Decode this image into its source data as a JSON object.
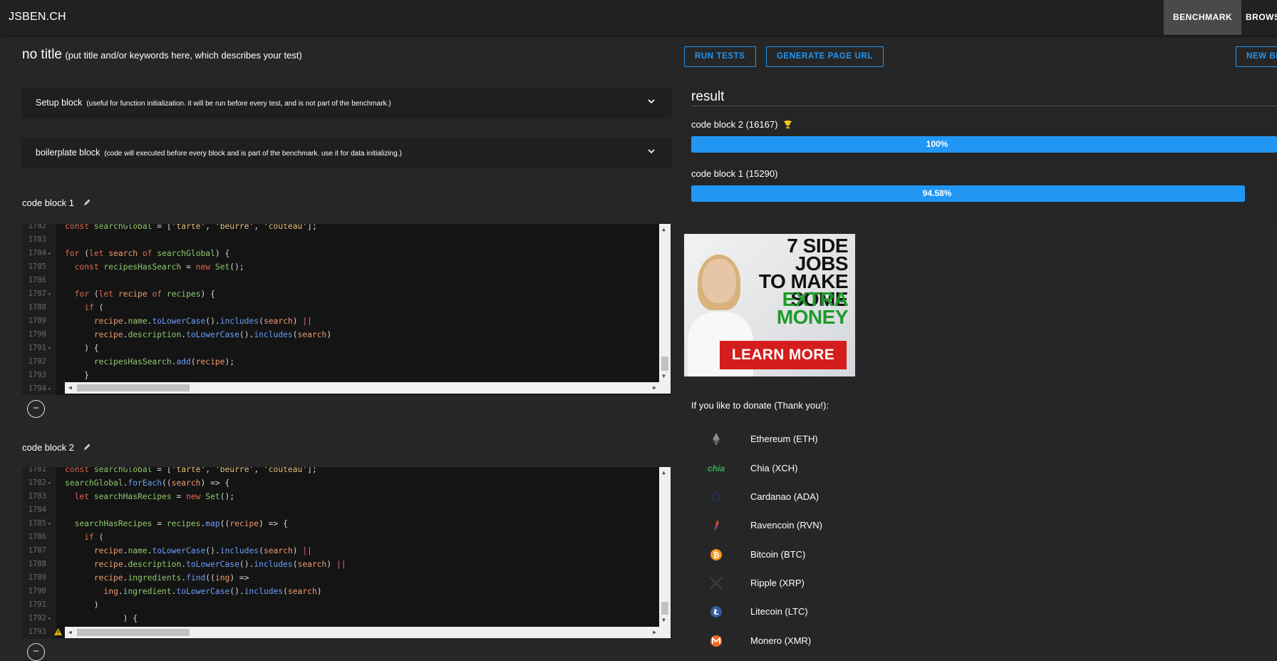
{
  "header": {
    "brand": "JSBEN.CH",
    "nav": [
      "BENCHMARK",
      "BROWS"
    ]
  },
  "test": {
    "title": "no title",
    "title_hint": "(put title and/or keywords here, which describes your test)"
  },
  "toolbar": {
    "run_tests": "RUN TESTS",
    "generate_url": "GENERATE PAGE URL",
    "new": "NEW BE"
  },
  "setup_block": {
    "label": "Setup block",
    "hint": "(useful for function initialization. it will be run before every test, and is not part of the benchmark.)"
  },
  "boilerplate_block": {
    "label": "boilerplate block",
    "hint": "(code will executed before every block and is part of the benchmark. use it for data initializing.)"
  },
  "code_blocks": [
    {
      "title": "code block 1",
      "lines": [
        {
          "n": "1782",
          "fold": false,
          "text": "const searchGlobal = ['tarte', 'beurre', 'couteau'];"
        },
        {
          "n": "1783",
          "fold": false,
          "text": ""
        },
        {
          "n": "1784",
          "fold": true,
          "text": "for (let search of searchGlobal) {"
        },
        {
          "n": "1785",
          "fold": false,
          "text": "  const recipesHasSearch = new Set();"
        },
        {
          "n": "1786",
          "fold": false,
          "text": ""
        },
        {
          "n": "1787",
          "fold": true,
          "text": "  for (let recipe of recipes) {"
        },
        {
          "n": "1788",
          "fold": false,
          "text": "    if ("
        },
        {
          "n": "1789",
          "fold": false,
          "text": "      recipe.name.toLowerCase().includes(search) ||"
        },
        {
          "n": "1790",
          "fold": false,
          "text": "      recipe.description.toLowerCase().includes(search)"
        },
        {
          "n": "1791",
          "fold": true,
          "text": "    ) {"
        },
        {
          "n": "1792",
          "fold": false,
          "text": "      recipesHasSearch.add(recipe);"
        },
        {
          "n": "1793",
          "fold": false,
          "text": "    }"
        },
        {
          "n": "1794",
          "fold": true,
          "text": ""
        }
      ]
    },
    {
      "title": "code block 2",
      "lines": [
        {
          "n": "1781",
          "fold": false,
          "text": "const searchGlobal = ['tarte', 'beurre', 'couteau'];"
        },
        {
          "n": "1782",
          "fold": true,
          "text": "searchGlobal.forEach((search) => {"
        },
        {
          "n": "1783",
          "fold": false,
          "text": "  let searchHasRecipes = new Set();"
        },
        {
          "n": "1784",
          "fold": false,
          "text": ""
        },
        {
          "n": "1785",
          "fold": true,
          "text": "  searchHasRecipes = recipes.map((recipe) => {"
        },
        {
          "n": "1786",
          "fold": false,
          "text": "    if ("
        },
        {
          "n": "1787",
          "fold": false,
          "text": "      recipe.name.toLowerCase().includes(search) ||"
        },
        {
          "n": "1788",
          "fold": false,
          "text": "      recipe.description.toLowerCase().includes(search) ||"
        },
        {
          "n": "1789",
          "fold": false,
          "text": "      recipe.ingredients.find((ing) =>"
        },
        {
          "n": "1790",
          "fold": false,
          "text": "        ing.ingredient.toLowerCase().includes(search)"
        },
        {
          "n": "1791",
          "fold": false,
          "text": "      )"
        },
        {
          "n": "1792",
          "fold": true,
          "text": "            ) {"
        },
        {
          "n": "1793",
          "fold": false,
          "text": ""
        }
      ]
    }
  ],
  "result": {
    "title": "result",
    "rows": [
      {
        "label": "code block 2 (16167)",
        "percent": 100,
        "percent_label": "100%",
        "winner": true
      },
      {
        "label": "code block 1 (15290)",
        "percent": 94.58,
        "percent_label": "94.58%",
        "winner": false
      }
    ]
  },
  "ad": {
    "headline": [
      "7 SIDE JOBS",
      "TO MAKE",
      "SOME"
    ],
    "highlight": [
      "EXTRA",
      "MONEY"
    ],
    "button": "LEARN MORE"
  },
  "donate": {
    "title": "If you like to donate (Thank you!):",
    "coins": [
      {
        "name": "Ethereum (ETH)",
        "icon": "ethereum-icon",
        "color": "#8c8c8c"
      },
      {
        "name": "Chia (XCH)",
        "icon": "chia-icon",
        "color": "#3aac59"
      },
      {
        "name": "Cardanao (ADA)",
        "icon": "cardano-icon",
        "color": "#1a3c8c"
      },
      {
        "name": "Ravencoin (RVN)",
        "icon": "ravencoin-icon",
        "color": "#e0452b"
      },
      {
        "name": "Bitcoin (BTC)",
        "icon": "bitcoin-icon",
        "color": "#f7931a"
      },
      {
        "name": "Ripple (XRP)",
        "icon": "ripple-icon",
        "color": "#3a3a3a"
      },
      {
        "name": "Litecoin (LTC)",
        "icon": "litecoin-icon",
        "color": "#345d9d"
      },
      {
        "name": "Monero (XMR)",
        "icon": "monero-icon",
        "color": "#f26822"
      }
    ],
    "chia_text": "chia"
  }
}
